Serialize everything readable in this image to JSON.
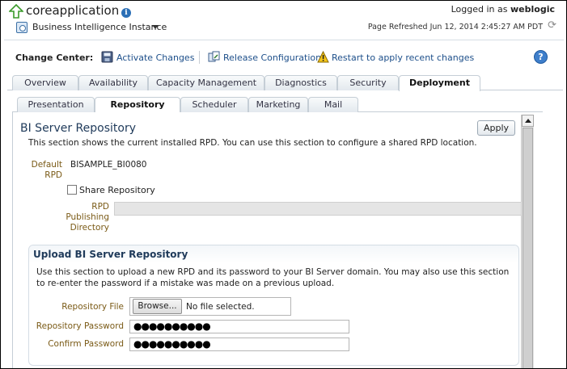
{
  "header": {
    "app_title": "coreapplication",
    "target_menu": "Business Intelligence Instance",
    "logged_in_prefix": "Logged in as",
    "logged_in_user": "weblogic",
    "page_refreshed": "Page Refreshed Jun 12, 2014 2:45:27 AM PDT"
  },
  "change_center": {
    "label": "Change Center:",
    "activate": "Activate Changes",
    "release": "Release Configuration",
    "restart": "Restart to apply recent changes"
  },
  "tabs": [
    {
      "label": "Overview",
      "selected": false
    },
    {
      "label": "Availability",
      "selected": false
    },
    {
      "label": "Capacity Management",
      "selected": false
    },
    {
      "label": "Diagnostics",
      "selected": false
    },
    {
      "label": "Security",
      "selected": false
    },
    {
      "label": "Deployment",
      "selected": true
    }
  ],
  "subtabs": [
    {
      "label": "Presentation",
      "selected": false
    },
    {
      "label": "Repository",
      "selected": true
    },
    {
      "label": "Scheduler",
      "selected": false
    },
    {
      "label": "Marketing",
      "selected": false
    },
    {
      "label": "Mail",
      "selected": false
    }
  ],
  "repository": {
    "title": "BI Server Repository",
    "apply": "Apply",
    "description": "This section shows the current installed RPD. You can use this section to configure a shared RPD location.",
    "default_rpd_label": "Default RPD",
    "default_rpd_value": "BISAMPLE_BI0080",
    "share_label": "Share Repository",
    "share_checked": false,
    "rpd_dir_label": "RPD Publishing Directory",
    "rpd_dir_value": ""
  },
  "upload": {
    "title": "Upload BI Server Repository",
    "description": "Use this section to upload a new RPD and its password to your BI Server domain. You may also use this section to re-enter the password if a mistake was made on a previous upload.",
    "repo_file_label": "Repository File",
    "browse": "Browse...",
    "file_status": "No file selected.",
    "password_label": "Repository Password",
    "password_value": "●●●●●●●●●●",
    "confirm_label": "Confirm Password",
    "confirm_value": "●●●●●●●●●●"
  },
  "colors": {
    "link": "#1d4f8a",
    "label": "#7a5a16",
    "heading": "#1f3a5a",
    "help": "#3f7fcb"
  }
}
